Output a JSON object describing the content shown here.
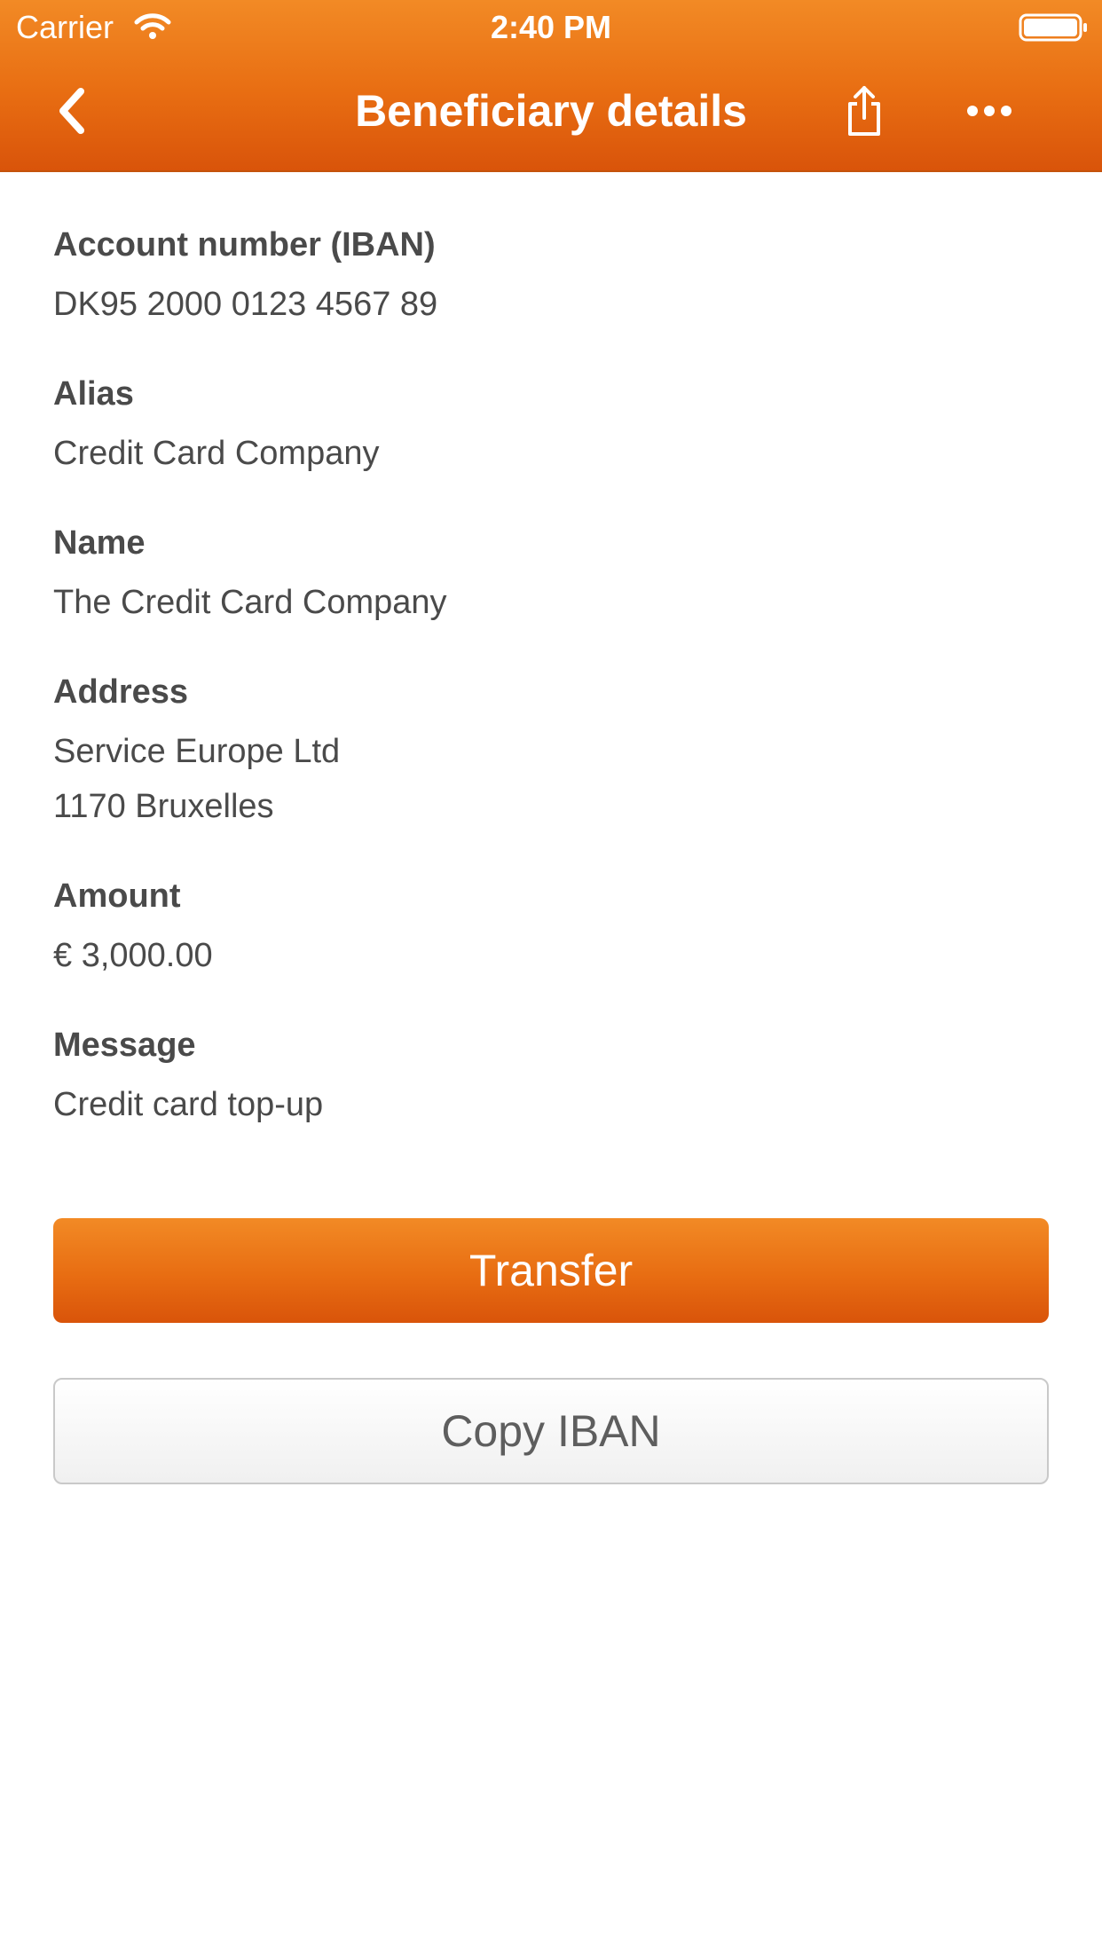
{
  "status_bar": {
    "carrier": "Carrier",
    "time": "2:40 PM"
  },
  "nav": {
    "title": "Beneficiary details",
    "back_icon": "chevron-left-icon",
    "share_icon": "share-icon",
    "more_icon": "more-horizontal-icon"
  },
  "fields": [
    {
      "label": "Account number (IBAN)",
      "lines": [
        "DK95 2000 0123 4567 89"
      ]
    },
    {
      "label": "Alias",
      "lines": [
        "Credit Card Company"
      ]
    },
    {
      "label": "Name",
      "lines": [
        "The Credit Card Company"
      ]
    },
    {
      "label": "Address",
      "lines": [
        "Service Europe Ltd",
        "1170 Bruxelles"
      ]
    },
    {
      "label": "Amount",
      "lines": [
        "€ 3,000.00"
      ]
    },
    {
      "label": "Message",
      "lines": [
        "Credit card top-up"
      ]
    }
  ],
  "actions": {
    "transfer_label": "Transfer",
    "copy_label": "Copy IBAN"
  },
  "colors": {
    "brand_orange": "#e86d12",
    "brand_orange_light": "#f28a25",
    "brand_orange_dark": "#d9540a",
    "text": "#4a4a4a",
    "secondary_button_text": "#5e5e5e"
  }
}
